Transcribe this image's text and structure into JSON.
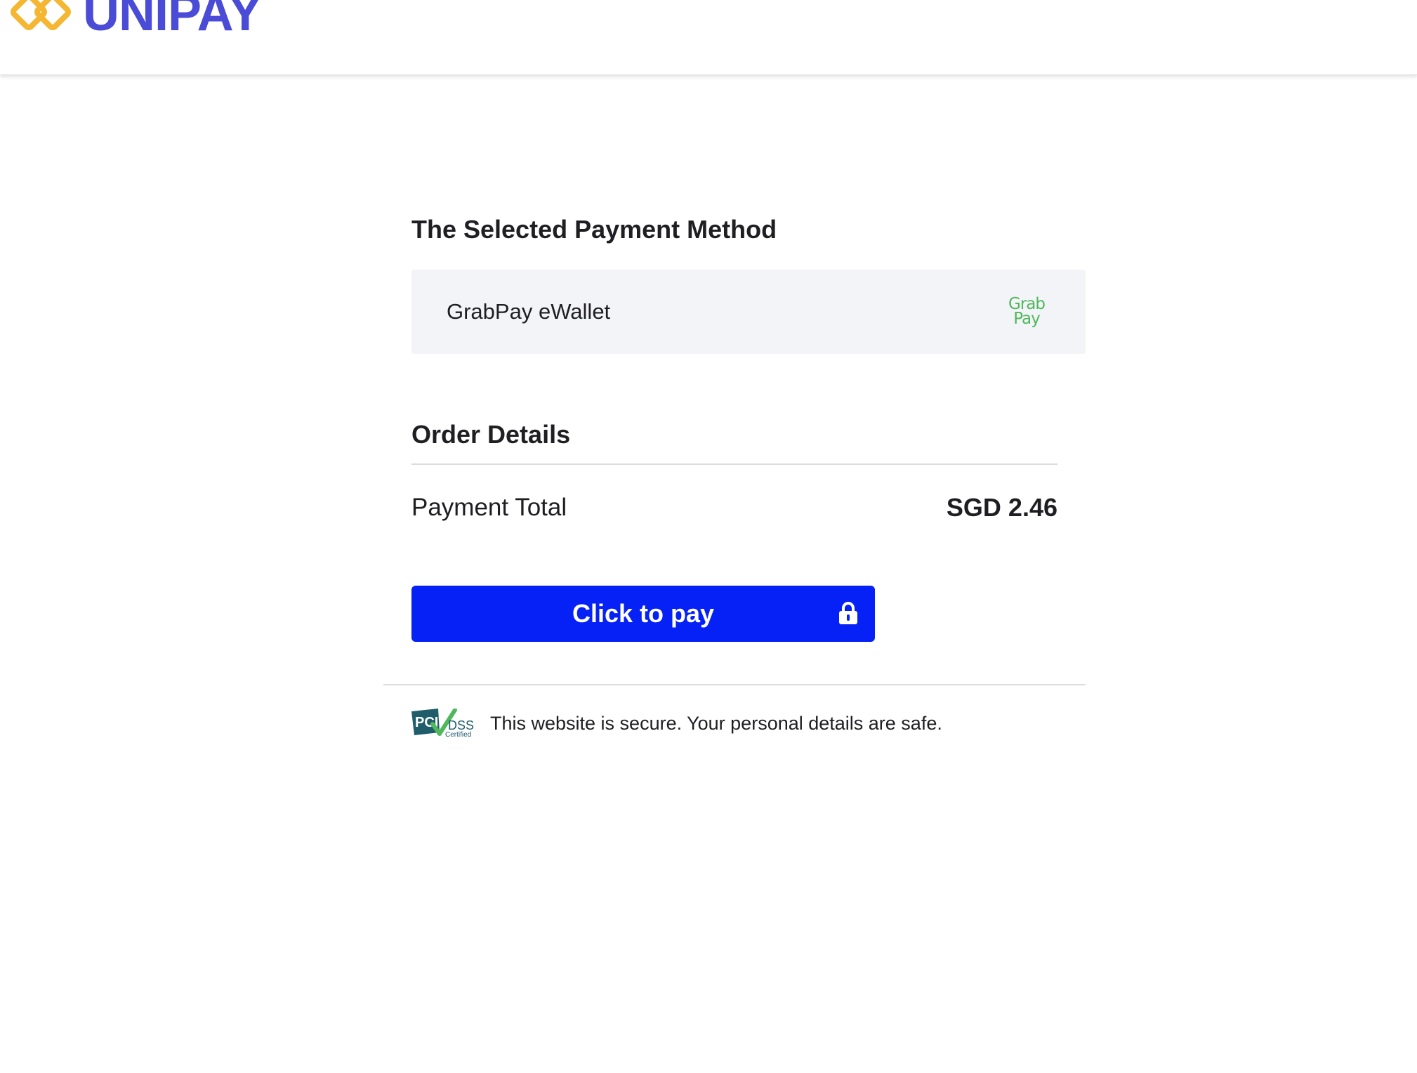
{
  "header": {
    "brand_name": "UNIPAY",
    "logo_icon": "diamond-links-icon",
    "brand_color": "#4a4bd6",
    "logo_accent": "#f5b632"
  },
  "payment_method": {
    "section_title": "The Selected Payment Method",
    "selected": {
      "name": "GrabPay eWallet",
      "logo_text_top": "Grab",
      "logo_text_bottom": "Pay",
      "logo_color": "#4fb85a"
    }
  },
  "order": {
    "section_title": "Order Details",
    "total_label": "Payment Total",
    "total_value": "SGD 2.46"
  },
  "pay_button": {
    "label": "Click to pay",
    "icon": "lock-icon",
    "color": "#0521f5"
  },
  "security": {
    "badge_icon": "pci-dss-certified-badge",
    "badge_text_pci": "PCI",
    "badge_text_dss": "DSS",
    "badge_text_certified": "Certified",
    "message": "This website is secure. Your personal details are safe."
  }
}
